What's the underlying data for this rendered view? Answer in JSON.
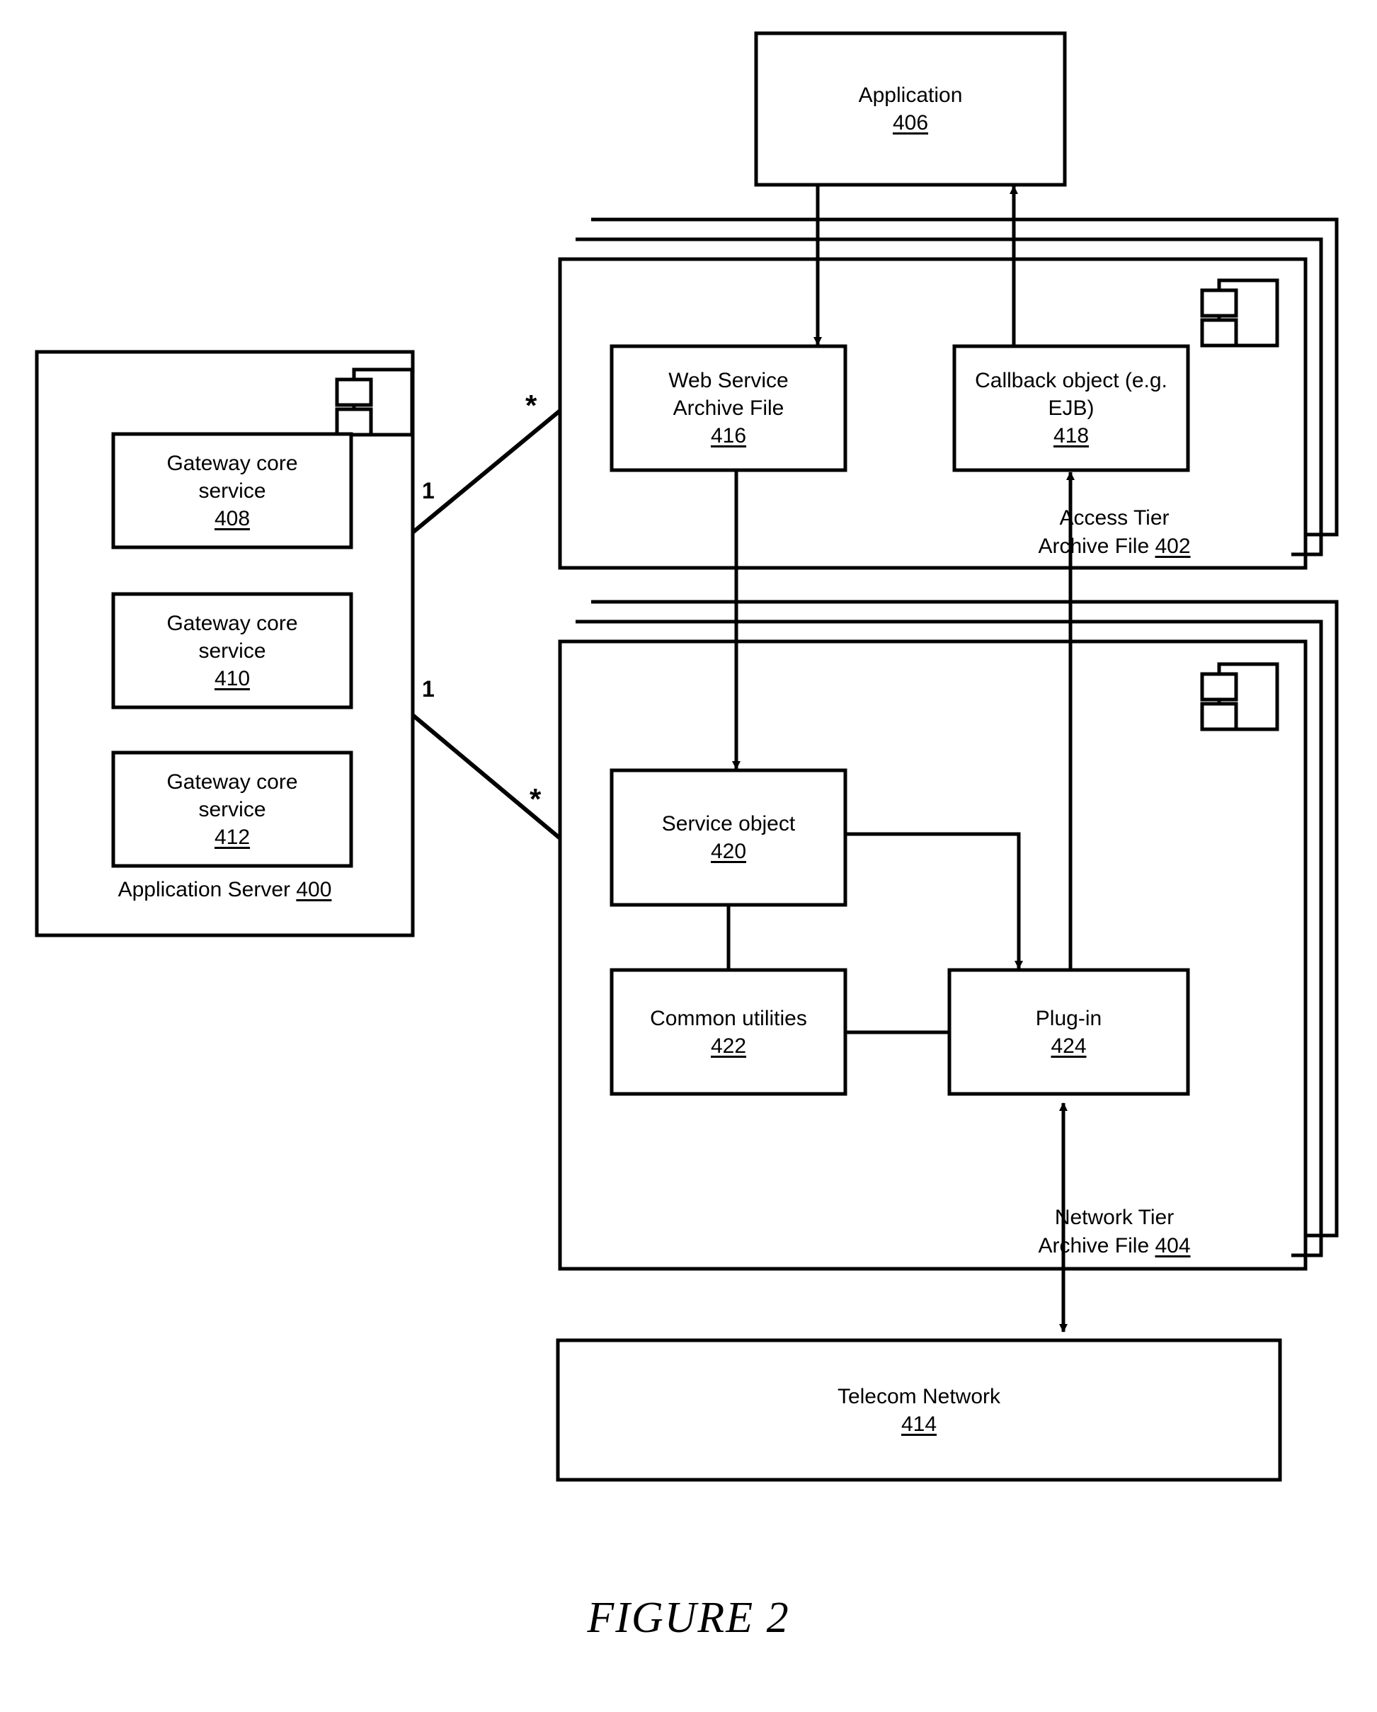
{
  "figure": {
    "caption": "FIGURE 2"
  },
  "nodes": {
    "application": {
      "title": "Application",
      "ref": "406"
    },
    "application_server": {
      "title": "Application Server",
      "ref": "400"
    },
    "gateway_core_service_408": {
      "title": "Gateway core\nservice",
      "ref": "408"
    },
    "gateway_core_service_410": {
      "title": "Gateway core\nservice",
      "ref": "410"
    },
    "gateway_core_service_412": {
      "title": "Gateway core\nservice",
      "ref": "412"
    },
    "access_tier": {
      "title": "Access Tier\nArchive File ",
      "ref": "402"
    },
    "web_service_archive_file": {
      "title": "Web Service\nArchive File",
      "ref": "416"
    },
    "callback_object": {
      "title": "Callback object (e.g.\nEJB)",
      "ref": "418"
    },
    "network_tier": {
      "title": "Network Tier\nArchive File ",
      "ref": "404"
    },
    "service_object": {
      "title": "Service object",
      "ref": "420"
    },
    "common_utilities": {
      "title": "Common utilities",
      "ref": "422"
    },
    "plugin": {
      "title": "Plug-in",
      "ref": "424"
    },
    "telecom_network": {
      "title": "Telecom Network",
      "ref": "414"
    }
  },
  "multiplicities": {
    "access_one": "1",
    "access_many": "*",
    "network_one": "1",
    "network_many": "*"
  },
  "icons": {
    "component_icon_access": "uml-component-icon",
    "component_icon_network": "uml-component-icon",
    "component_icon_appserver": "uml-component-icon"
  },
  "colors": {
    "stroke": "#000000",
    "background": "#ffffff"
  }
}
